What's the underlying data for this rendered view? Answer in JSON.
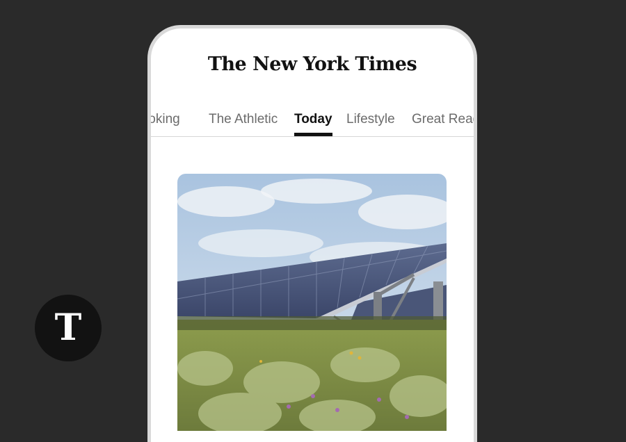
{
  "masthead": {
    "title": "The New York Times"
  },
  "tabs": [
    {
      "label": "Cooking",
      "active": false
    },
    {
      "label": "The Athletic",
      "active": false
    },
    {
      "label": "Today",
      "active": true
    },
    {
      "label": "Lifestyle",
      "active": false
    },
    {
      "label": "Great Reads",
      "active": false
    }
  ],
  "hero_image": {
    "subject": "solar-panels-in-meadow"
  },
  "logo_badge": {
    "glyph": "T"
  },
  "colors": {
    "background": "#2a2a2a",
    "phone_frame": "#d9d9d9",
    "active_tab": "#121212",
    "inactive_tab": "#6b6b6b"
  }
}
